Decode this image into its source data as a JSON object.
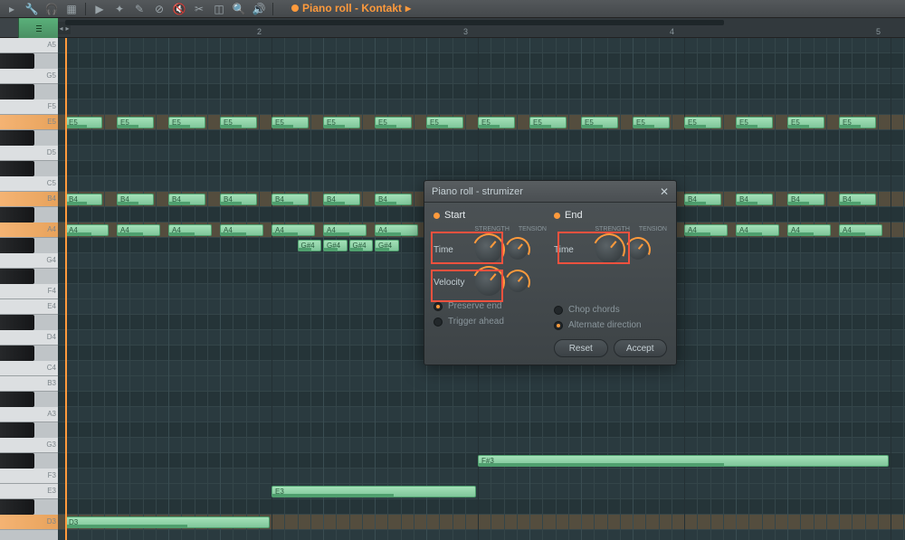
{
  "toolbar": {
    "title": "Piano roll - Kontakt",
    "title_arrow": "▸"
  },
  "ruler": {
    "bars": [
      2,
      3,
      4,
      5
    ]
  },
  "piano": {
    "labels": [
      "A5",
      "G5",
      "F5",
      "E5",
      "D5",
      "C5",
      "B4",
      "A4",
      "G4",
      "F4",
      "E4",
      "D4",
      "C4",
      "B3",
      "A3",
      "G3",
      "F3",
      "E3",
      "D3"
    ]
  },
  "notes": {
    "e5": "E5",
    "b4": "B4",
    "a4": "A4",
    "gs4": "G#4",
    "fs3": "F#3",
    "e3": "E3",
    "d3": "D3"
  },
  "dialog": {
    "title": "Piano roll - strumizer",
    "start": "Start",
    "end": "End",
    "strength": "STRENGTH",
    "tension": "TENSION",
    "time": "Time",
    "velocity": "Velocity",
    "preserve_end": "Preserve end",
    "trigger_ahead": "Trigger ahead",
    "chop_chords": "Chop chords",
    "alternate_direction": "Alternate direction",
    "reset": "Reset",
    "accept": "Accept"
  }
}
